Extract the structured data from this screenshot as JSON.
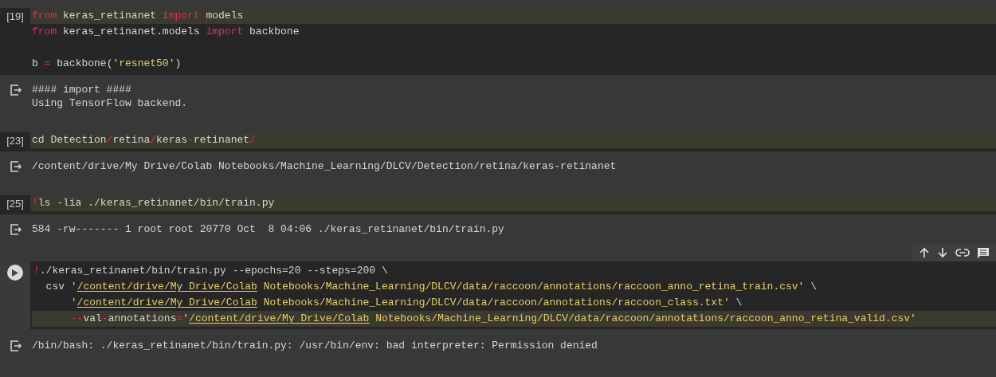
{
  "cells": [
    {
      "kind": "executed",
      "count": "[19]",
      "lines": [
        {
          "highlighted": true,
          "tokens": [
            {
              "text": "from",
              "kind": "keyword"
            },
            {
              "text": " keras_retinanet ",
              "kind": "plain"
            },
            {
              "text": "import",
              "kind": "keyword"
            },
            {
              "text": " models",
              "kind": "plain"
            }
          ]
        },
        {
          "highlighted": false,
          "tokens": [
            {
              "text": "from",
              "kind": "keyword"
            },
            {
              "text": " keras_retinanet.models ",
              "kind": "plain"
            },
            {
              "text": "import",
              "kind": "keyword"
            },
            {
              "text": " backbone",
              "kind": "plain"
            }
          ]
        },
        {
          "highlighted": false
        },
        {
          "highlighted": false,
          "tokens": [
            {
              "text": "b ",
              "kind": "plain"
            },
            {
              "text": "=",
              "kind": "keyword"
            },
            {
              "text": " backbone(",
              "kind": "plain"
            },
            {
              "text": "'resnet50'",
              "kind": "string"
            },
            {
              "text": ")",
              "kind": "plain"
            }
          ]
        }
      ],
      "outputs": [
        "#### import ####",
        "Using TensorFlow backend."
      ]
    },
    {
      "kind": "executed",
      "count": "[23]",
      "lines": [
        {
          "highlighted": true,
          "tokens": [
            {
              "text": "cd Detection",
              "kind": "plain"
            },
            {
              "text": "/",
              "kind": "keyword"
            },
            {
              "text": "retina",
              "kind": "plain"
            },
            {
              "text": "/",
              "kind": "keyword"
            },
            {
              "text": "keras",
              "kind": "plain"
            },
            {
              "text": "-",
              "kind": "keyword"
            },
            {
              "text": "retinanet",
              "kind": "plain"
            },
            {
              "text": "/",
              "kind": "keyword"
            }
          ]
        }
      ],
      "outputs": [
        "/content/drive/My Drive/Colab Notebooks/Machine_Learning/DLCV/Detection/retina/keras-retinanet"
      ]
    },
    {
      "kind": "executed",
      "count": "[25]",
      "lines": [
        {
          "highlighted": true,
          "tokens": [
            {
              "text": "!",
              "kind": "keyword"
            },
            {
              "text": "ls -lia ./keras_retinanet/bin/train.py",
              "kind": "plain"
            }
          ]
        }
      ],
      "outputs": [
        "584 -rw------- 1 root root 20770 Oct  8 04:06 ./keras_retinanet/bin/train.py"
      ]
    },
    {
      "kind": "focused",
      "lines": [
        {
          "highlighted": false,
          "tokens": [
            {
              "text": "!",
              "kind": "keyword"
            },
            {
              "text": "./keras_retinanet/bin/train.py --epochs=20 --steps=200 \\",
              "kind": "plain"
            }
          ]
        },
        {
          "highlighted": false,
          "tokens": [
            {
              "text": "  csv ",
              "kind": "plain"
            },
            {
              "text": "'",
              "kind": "string"
            },
            {
              "text": "/content/drive/My Drive/Colab",
              "kind": "link"
            },
            {
              "text": " Notebooks/Machine_Learning/DLCV/data/raccoon/annotations/raccoon_anno_retina_train.csv'",
              "kind": "string"
            },
            {
              "text": " \\",
              "kind": "plain"
            }
          ]
        },
        {
          "highlighted": false,
          "tokens": [
            {
              "text": "      '",
              "kind": "string"
            },
            {
              "text": "/content/drive/My Drive/Colab",
              "kind": "link"
            },
            {
              "text": " Notebooks/Machine_Learning/DLCV/data/raccoon/annotations/raccoon_class.txt'",
              "kind": "string"
            },
            {
              "text": " \\",
              "kind": "plain"
            }
          ]
        },
        {
          "highlighted": true,
          "tokens": [
            {
              "text": "      --",
              "kind": "keyword"
            },
            {
              "text": "val",
              "kind": "plain"
            },
            {
              "text": "-",
              "kind": "keyword"
            },
            {
              "text": "annotations",
              "kind": "plain"
            },
            {
              "text": "=",
              "kind": "keyword"
            },
            {
              "text": "'",
              "kind": "string"
            },
            {
              "text": "/content/drive/My Drive/Colab",
              "kind": "link"
            },
            {
              "text": " Notebooks/Machine_Learning/DLCV/data/raccoon/annotations/raccoon_anno_retina_valid.csv'",
              "kind": "string"
            }
          ]
        }
      ],
      "outputs": [
        "/bin/bash: ./keras_retinanet/bin/train.py: /usr/bin/env: bad interpreter: Permission denied"
      ]
    }
  ]
}
